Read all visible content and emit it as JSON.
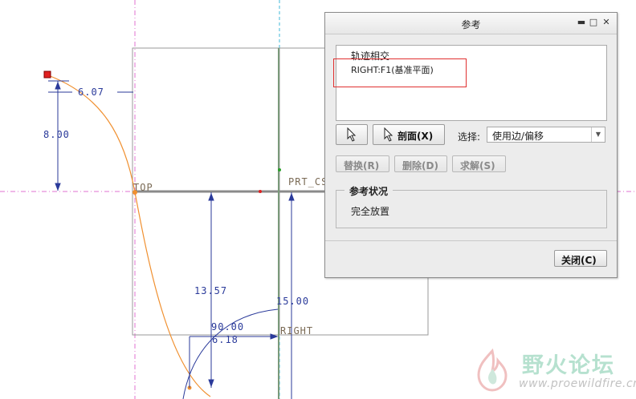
{
  "sketch": {
    "dimensions": [
      "6.07",
      "8.00",
      "13.57",
      "90.00",
      "6.18",
      "15.00"
    ],
    "datum_labels": {
      "top": "TOP",
      "prt_csys": "PRT_CS",
      "right": "RIGHT"
    },
    "colors": {
      "curve": "#f09030",
      "dimension": "#2a3a9a",
      "datum_centerline": "#e070d0",
      "axis": "#40b8d8"
    }
  },
  "dialog": {
    "title": "参考",
    "window_buttons": [
      "minimize-icon",
      "maximize-icon",
      "close-icon"
    ],
    "references": [
      "轨迹相交",
      "RIGHT:F1(基准平面)"
    ],
    "buttons": {
      "cursor": "cursor-icon",
      "section": "剖面(X)",
      "replace": "替换(R)",
      "delete": "删除(D)",
      "solve": "求解(S)",
      "close": "关闭(C)"
    },
    "select_label": "选择:",
    "select_value": "使用边/偏移",
    "status_title": "参考状况",
    "status_value": "完全放置"
  },
  "watermark": {
    "title": "野火论坛",
    "url": "www.proewildfire.cn"
  }
}
